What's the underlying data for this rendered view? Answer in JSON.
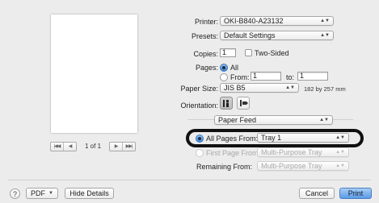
{
  "preview": {
    "nav_first": "|◀◀",
    "nav_prev": "◀",
    "nav_next": "▶",
    "nav_last": "▶▶|",
    "page_indicator": "1 of 1"
  },
  "printer": {
    "label": "Printer:",
    "value": "OKI-B840-A23132"
  },
  "presets": {
    "label": "Presets:",
    "value": "Default Settings"
  },
  "copies": {
    "label": "Copies:",
    "value": "1",
    "two_sided_label": "Two-Sided",
    "two_sided_checked": false
  },
  "pages": {
    "label": "Pages:",
    "all_label": "All",
    "from_label": "From:",
    "from_value": "1",
    "to_label": "to:",
    "to_value": "1",
    "selected": "All"
  },
  "paper_size": {
    "label": "Paper Size:",
    "value": "JIS B5",
    "dimensions": "182 by 257 mm"
  },
  "orientation": {
    "label": "Orientation:",
    "selected": "portrait"
  },
  "section_menu": {
    "value": "Paper Feed"
  },
  "paper_feed": {
    "all_pages_from_label": "All Pages From:",
    "all_pages_from_value": "Tray 1",
    "first_page_from_label": "First Page From:",
    "first_page_from_value": "Multi-Purpose Tray",
    "remaining_from_label": "Remaining From:",
    "remaining_from_value": "Multi-Purpose Tray",
    "selected": "all_pages"
  },
  "footer": {
    "help": "?",
    "pdf_label": "PDF",
    "hide_details_label": "Hide Details",
    "cancel_label": "Cancel",
    "print_label": "Print"
  },
  "colors": {
    "accent": "#5b9be6",
    "highlight_ring": "#111111"
  }
}
